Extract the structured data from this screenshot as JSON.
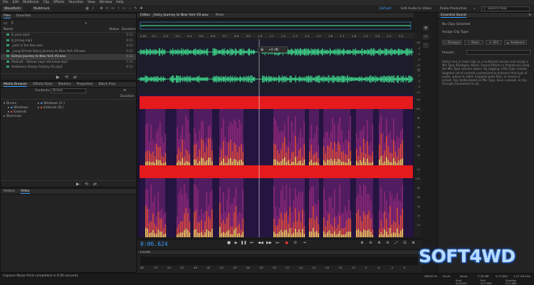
{
  "menu": [
    "File",
    "Edit",
    "Multitrack",
    "Clip",
    "Effects",
    "Favorites",
    "View",
    "Window",
    "Help"
  ],
  "toolbar": {
    "waveform_tab": "Waveform",
    "multitrack_tab": "Multitrack",
    "workspaces": [
      "Default",
      "Edit Audio to Video",
      "Radio Production"
    ],
    "search_placeholder": "Search Help"
  },
  "files_panel": {
    "tabs": [
      "Files",
      "Favorites"
    ],
    "columns": {
      "name": "Name",
      "status": "Status",
      "duration": "Duration"
    },
    "items": [
      {
        "name": "8_area.mp3",
        "duration": "0:11"
      },
      {
        "name": "8_jiming.mp3",
        "duration": "0:11"
      },
      {
        "name": "_Jack in the Box.wav",
        "duration": "0:21"
      },
      {
        "name": "_Long Glimse Halcy Journey to New York VO.wav",
        "duration": "0:22"
      },
      {
        "name": "Glimse Journey to New York VO.wav",
        "duration": "0:22"
      },
      {
        "name": "Podcast - Steven says interview.mp3",
        "duration": "1:15"
      },
      {
        "name": "Ambience Stomp Factory 01.mp3",
        "duration": "0:11"
      }
    ]
  },
  "media_browser": {
    "tabs": [
      "Media Browser",
      "Effects Rack",
      "Markers",
      "Properties",
      "Batch Proc"
    ],
    "contents_label": "Contents:",
    "contents_value": "Drives",
    "duration_header": "Duration",
    "tree": [
      "Drives",
      "Windows",
      "Extends",
      "Shortcuts"
    ],
    "drives": [
      "Windows (C:)",
      "Extends (D:)"
    ]
  },
  "bottom_left_tabs": [
    "History",
    "Video"
  ],
  "editor": {
    "tabs": [
      "Editor: _Halcy Journey to New York VO.wav",
      "Mixer"
    ],
    "ruler_marks": [
      "0:00",
      "0:1",
      "0:2",
      "0:3",
      "0:4",
      "0:5",
      "0:6",
      "0:7",
      "0:8",
      "0:9",
      "1:0",
      "1:1",
      "1:2",
      "1:3",
      "1:4",
      "1:5",
      "1:6",
      "1:7",
      "1:8",
      "1:9",
      "2:0",
      "2:1",
      "2:2"
    ],
    "hud_gain": "+0 dB",
    "db_labels": [
      "dB",
      "-3",
      "-6",
      "-9",
      "-15",
      "-∞",
      "dB",
      "-3",
      "-6",
      "-9",
      "-15"
    ],
    "hz_labels": [
      "Hz",
      "10k",
      "8k",
      "6k",
      "4k",
      "2k",
      "1k",
      "Hz",
      "10k",
      "8k",
      "6k",
      "4k",
      "2k",
      "1k"
    ]
  },
  "transport": {
    "time": "0:06.624"
  },
  "levels": {
    "title": "Levels",
    "scale": [
      "dB",
      "-57",
      "-54",
      "-51",
      "-48",
      "-45",
      "-42",
      "-39",
      "-36",
      "-33",
      "-30",
      "-27",
      "-24",
      "-21",
      "-18",
      "-15",
      "-12",
      "-9",
      "-6",
      "-3",
      "0"
    ]
  },
  "status": {
    "message": "Capture Noise Print completed in 0.00 seconds",
    "right": [
      "48000 Hz",
      "16-bit",
      "Mono",
      "3.28 MB",
      "0:17.660",
      "4.47 GB free"
    ],
    "selection_headers": [
      "Start",
      "End",
      "Duration"
    ],
    "selection_values": [
      "0:00.000",
      "0:17.660",
      "0:17.660"
    ]
  },
  "essential_sound": {
    "title": "Essential Sound",
    "no_clip": "No Clips Selected",
    "assign_label": "Assign Clip Type:",
    "types": [
      "Dialogue",
      "Music",
      "SFX",
      "Ambience"
    ],
    "preset_label": "Presets:",
    "help_text": "Select one or more clips in a multitrack session and assign a Mix Type (Dialogue, Music, Sound Effects or Ambience) using the Mix Type selector above. By tagging a Mix Type, simple, targeted set of controls customized to enhance that type of audio, reduce it, other mapped audio files, or ensure a preset. Tag media based on Mix Type. Save a preset, or clip through mechanism to all."
  },
  "watermark": "SOFT4WD",
  "colors": {
    "accent": "#3aa0ff",
    "waveform": "#3fd98e",
    "spectral_band": "#e41a1c",
    "background": "#1d1d1d"
  }
}
